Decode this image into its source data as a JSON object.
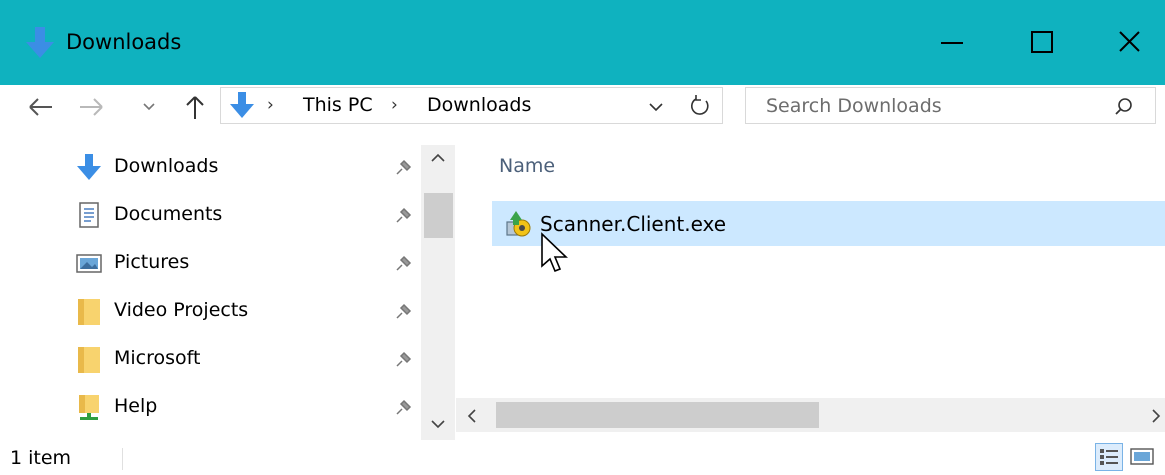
{
  "window": {
    "title": "Downloads",
    "title_icon": "download-arrow-icon",
    "controls": [
      "minimize-icon",
      "maximize-icon",
      "close-icon"
    ],
    "accent": "#0fb2bf"
  },
  "toolbar": {
    "back_icon": "arrow-left-icon",
    "forward_icon": "arrow-right-icon",
    "recent_icon": "chevron-down-icon",
    "up_icon": "arrow-up-icon",
    "breadcrumb": [
      "This PC",
      "Downloads"
    ],
    "refresh_icon": "refresh-icon",
    "search_placeholder": "Search Downloads",
    "search_icon": "search-icon"
  },
  "nav_pane": {
    "items": [
      {
        "label": "Downloads",
        "icon": "download-arrow-icon",
        "pinned": true
      },
      {
        "label": "Documents",
        "icon": "document-icon",
        "pinned": true
      },
      {
        "label": "Pictures",
        "icon": "pictures-icon",
        "pinned": true
      },
      {
        "label": "Video Projects",
        "icon": "folder-icon",
        "pinned": true
      },
      {
        "label": "Microsoft",
        "icon": "folder-icon",
        "pinned": true
      },
      {
        "label": "Help",
        "icon": "network-folder-icon",
        "pinned": true
      }
    ]
  },
  "file_list": {
    "column_header": "Name",
    "files": [
      {
        "name": "Scanner.Client.exe",
        "icon": "installer-icon",
        "selected": true
      }
    ],
    "selection_color": "#cce8ff"
  },
  "status": {
    "item_count": "1 item",
    "views": [
      "details-view-icon",
      "large-icons-view-icon"
    ]
  }
}
